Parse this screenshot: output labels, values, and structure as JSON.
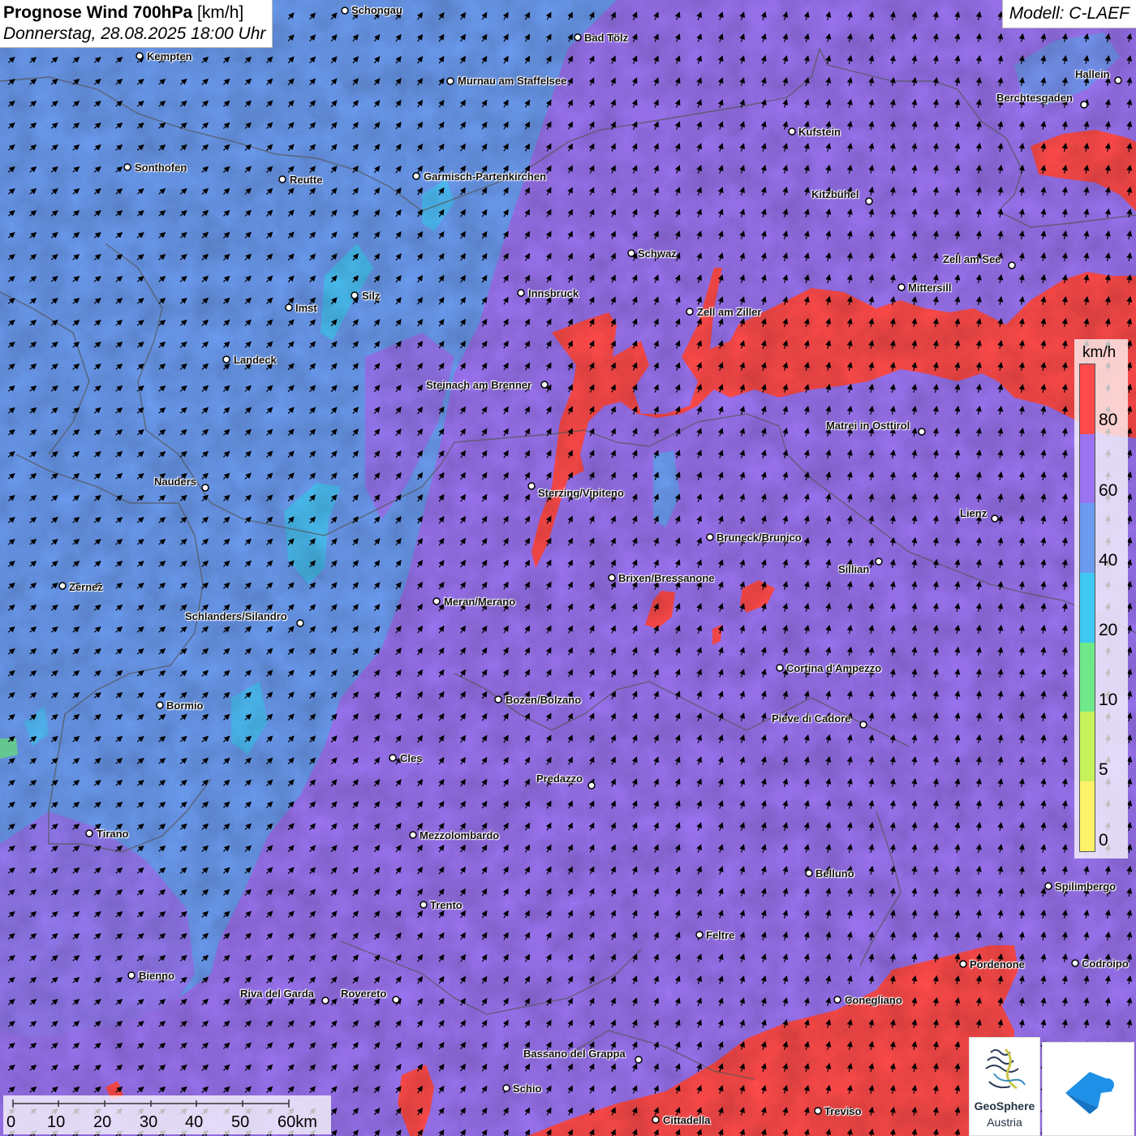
{
  "title": {
    "bold": "Prognose Wind 700hPa",
    "unit": "[km/h]",
    "date": "Donnerstag, 28.08.2025 18:00 Uhr"
  },
  "model": "Modell: C-LAEF",
  "legend": {
    "unit": "km/h",
    "levels": [
      "80",
      "60",
      "40",
      "20",
      "10",
      "5",
      "0"
    ],
    "colors": [
      "#ff4a4a",
      "#9a73f0",
      "#6b9bf0",
      "#3fc8f3",
      "#6fe88a",
      "#c8f25c",
      "#fdf36a"
    ]
  },
  "scalebar": {
    "labels": [
      "0",
      "10",
      "20",
      "30",
      "40",
      "50",
      "60km"
    ]
  },
  "logo": {
    "name1": "GeoSphere",
    "name2": "Austria"
  },
  "cities": [
    {
      "name": "Schongau"
    },
    {
      "name": "Bad Tölz"
    },
    {
      "name": "Kempten"
    },
    {
      "name": "Murnau am Staffelsee"
    },
    {
      "name": "Hallein"
    },
    {
      "name": "Berchtesgaden"
    },
    {
      "name": "Kufstein"
    },
    {
      "name": "Sonthofen"
    },
    {
      "name": "Reutte"
    },
    {
      "name": "Garmisch-Partenkirchen"
    },
    {
      "name": "Kitzbühel"
    },
    {
      "name": "Schwaz"
    },
    {
      "name": "Zell am See"
    },
    {
      "name": "Mittersill"
    },
    {
      "name": "Silz"
    },
    {
      "name": "Innsbruck"
    },
    {
      "name": "Imst"
    },
    {
      "name": "Zell am Ziller"
    },
    {
      "name": "Landeck"
    },
    {
      "name": "Steinach am Brenner"
    },
    {
      "name": "Matrei in Osttirol"
    },
    {
      "name": "Nauders"
    },
    {
      "name": "Sterzing/Vipiteno"
    },
    {
      "name": "Lienz"
    },
    {
      "name": "Bruneck/Brunico"
    },
    {
      "name": "Sillian"
    },
    {
      "name": "Zernez"
    },
    {
      "name": "Brixen/Bressanone"
    },
    {
      "name": "Meran/Merano"
    },
    {
      "name": "Schlanders/Silandro"
    },
    {
      "name": "Cortina d'Ampezzo"
    },
    {
      "name": "Bormio"
    },
    {
      "name": "Bozen/Bolzano"
    },
    {
      "name": "Pieve di Cadore"
    },
    {
      "name": "Cles"
    },
    {
      "name": "Predazzo"
    },
    {
      "name": "Tirano"
    },
    {
      "name": "Mezzolombardo"
    },
    {
      "name": "Belluno"
    },
    {
      "name": "Spilimbergo"
    },
    {
      "name": "Trento"
    },
    {
      "name": "Feltre"
    },
    {
      "name": "Pordenone"
    },
    {
      "name": "Codroipo"
    },
    {
      "name": "Bienno"
    },
    {
      "name": "Riva del Garda"
    },
    {
      "name": "Rovereto"
    },
    {
      "name": "Conegliano"
    },
    {
      "name": "Bassano del Grappa"
    },
    {
      "name": "Schio"
    },
    {
      "name": "Cittadella"
    },
    {
      "name": "Treviso"
    }
  ]
}
